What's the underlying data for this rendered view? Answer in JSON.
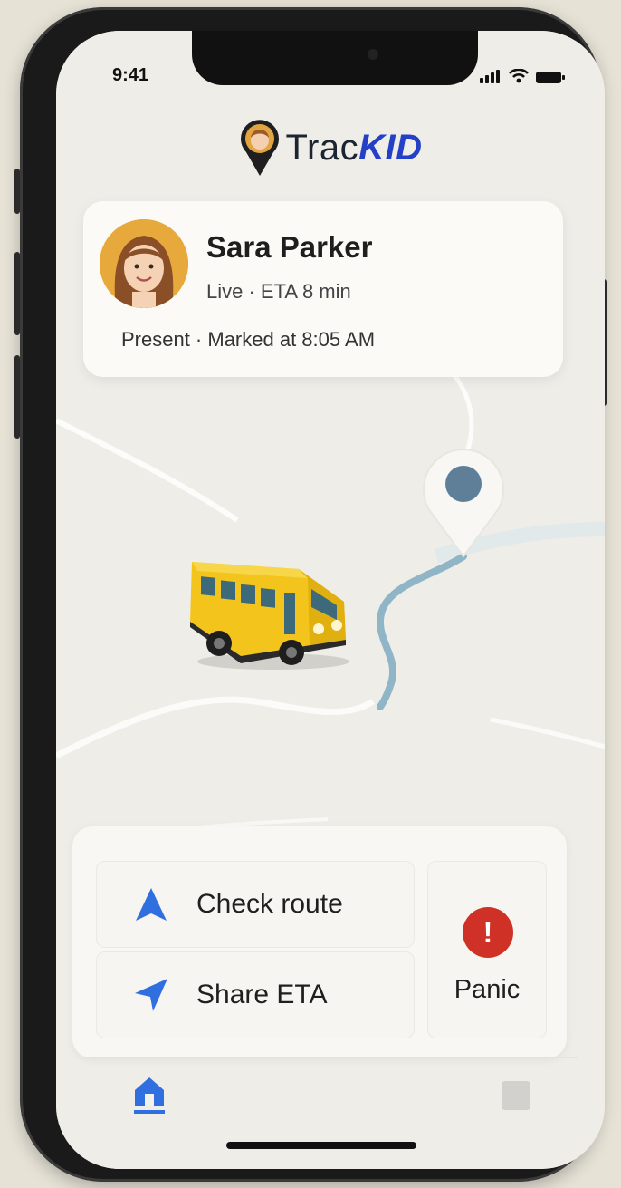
{
  "status_bar": {
    "time": "9:41"
  },
  "app": {
    "name_prefix": "Trac",
    "name_suffix": "KID"
  },
  "child": {
    "name": "Sara Parker",
    "status": "Live · ETA 8 min",
    "attendance": "Present · Marked at 8:05 AM"
  },
  "actions": {
    "check_route": "Check route",
    "share_eta": "Share ETA",
    "panic": "Panic",
    "panic_symbol": "!"
  },
  "tabs": [
    {
      "icon": "home-icon",
      "active": true
    },
    {
      "icon": "square-icon",
      "active": false
    }
  ],
  "colors": {
    "accent": "#2340c7",
    "action_blue": "#2f6fe0",
    "panic_red": "#cf3126",
    "route": "#8fb5c7",
    "bus_yellow": "#f2c41c"
  }
}
